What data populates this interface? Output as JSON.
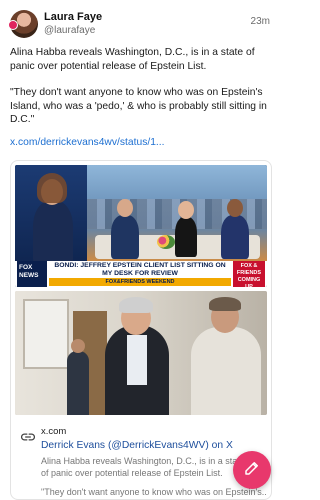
{
  "post": {
    "author": {
      "display_name": "Laura Faye",
      "handle": "@laurafaye"
    },
    "time": "23m",
    "paragraphs": [
      "Alina Habba reveals Washington, D.C., is in a state of panic over potential release of Epstein List.",
      "\"They don't want anyone to know who was on Epstein's Island, who was a 'pedo,' & who is probably still sitting in D.C.\""
    ],
    "link": "x.com/derrickevans4wv/status/1..."
  },
  "link_card": {
    "image1": {
      "network_logo": "FOX NEWS",
      "chyron_headline": "BONDI: JEFFREY EPSTEIN CLIENT LIST SITTING ON MY DESK FOR REVIEW",
      "chyron_band": "FOX&FRIENDS WEEKEND",
      "chyron_right": "FOX & FRIENDS COMING UP"
    },
    "domain": "x.com",
    "title": "Derrick Evans (@DerrickEvans4WV) on X",
    "description": "Alina Habba reveals Washington, D.C., is in a state of panic over potential release of Epstein List.",
    "description_more": "\"They don't want anyone to know who was on Epstein's..."
  },
  "icons": {
    "link": "link-icon",
    "compose": "compose-pencil-icon"
  },
  "colors": {
    "accent": "#e8386c",
    "link": "#1d6fd1"
  }
}
